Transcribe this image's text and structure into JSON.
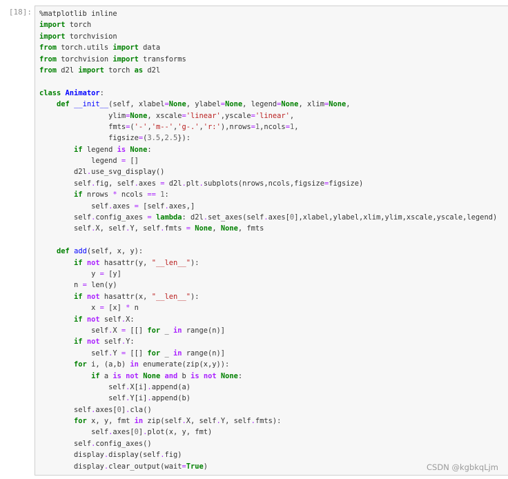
{
  "cell": {
    "prompt": "[18]:"
  },
  "watermark": "CSDN @kgbkqLjm",
  "code_lines": [
    [
      [
        "mg",
        "%matplotlib inline"
      ]
    ],
    [
      [
        "k",
        "import"
      ],
      [
        "t",
        " torch"
      ]
    ],
    [
      [
        "k",
        "import"
      ],
      [
        "t",
        " torchvision"
      ]
    ],
    [
      [
        "k",
        "from"
      ],
      [
        "t",
        " torch.utils "
      ],
      [
        "k",
        "import"
      ],
      [
        "t",
        " data"
      ]
    ],
    [
      [
        "k",
        "from"
      ],
      [
        "t",
        " torchvision "
      ],
      [
        "k",
        "import"
      ],
      [
        "t",
        " transforms"
      ]
    ],
    [
      [
        "k",
        "from"
      ],
      [
        "t",
        " d2l "
      ],
      [
        "k",
        "import"
      ],
      [
        "t",
        " torch "
      ],
      [
        "k",
        "as"
      ],
      [
        "t",
        " d2l"
      ]
    ],
    [],
    [
      [
        "k",
        "class"
      ],
      [
        "t",
        " "
      ],
      [
        "nc",
        "Animator"
      ],
      [
        "t",
        ":"
      ]
    ],
    [
      [
        "t",
        "    "
      ],
      [
        "k",
        "def"
      ],
      [
        "t",
        " "
      ],
      [
        "nf",
        "__init__"
      ],
      [
        "t",
        "(self, xlabel"
      ],
      [
        "o",
        "="
      ],
      [
        "kc",
        "None"
      ],
      [
        "t",
        ", ylabel"
      ],
      [
        "o",
        "="
      ],
      [
        "kc",
        "None"
      ],
      [
        "t",
        ", legend"
      ],
      [
        "o",
        "="
      ],
      [
        "kc",
        "None"
      ],
      [
        "t",
        ", xlim"
      ],
      [
        "o",
        "="
      ],
      [
        "kc",
        "None"
      ],
      [
        "t",
        ","
      ]
    ],
    [
      [
        "t",
        "                ylim"
      ],
      [
        "o",
        "="
      ],
      [
        "kc",
        "None"
      ],
      [
        "t",
        ", xscale"
      ],
      [
        "o",
        "="
      ],
      [
        "s",
        "'linear'"
      ],
      [
        "t",
        ",yscale"
      ],
      [
        "o",
        "="
      ],
      [
        "s",
        "'linear'"
      ],
      [
        "t",
        ","
      ]
    ],
    [
      [
        "t",
        "                fmts"
      ],
      [
        "o",
        "="
      ],
      [
        "t",
        "("
      ],
      [
        "s",
        "'-'"
      ],
      [
        "t",
        ","
      ],
      [
        "s",
        "'m--'"
      ],
      [
        "t",
        ","
      ],
      [
        "s",
        "'g-.'"
      ],
      [
        "t",
        ","
      ],
      [
        "s",
        "'r:'"
      ],
      [
        "t",
        "),nrows"
      ],
      [
        "o",
        "="
      ],
      [
        "m",
        "1"
      ],
      [
        "t",
        ",ncols"
      ],
      [
        "o",
        "="
      ],
      [
        "m",
        "1"
      ],
      [
        "t",
        ","
      ]
    ],
    [
      [
        "t",
        "                figsize"
      ],
      [
        "o",
        "="
      ],
      [
        "t",
        "("
      ],
      [
        "m",
        "3.5"
      ],
      [
        "t",
        ","
      ],
      [
        "m",
        "2.5"
      ],
      [
        "t",
        "}):"
      ]
    ],
    [
      [
        "t",
        "        "
      ],
      [
        "k",
        "if"
      ],
      [
        "t",
        " legend "
      ],
      [
        "ow",
        "is"
      ],
      [
        "t",
        " "
      ],
      [
        "kc",
        "None"
      ],
      [
        "t",
        ":"
      ]
    ],
    [
      [
        "t",
        "            legend "
      ],
      [
        "o",
        "="
      ],
      [
        "t",
        " []"
      ]
    ],
    [
      [
        "t",
        "        d2l"
      ],
      [
        "o",
        "."
      ],
      [
        "t",
        "use_svg_display()"
      ]
    ],
    [
      [
        "t",
        "        self"
      ],
      [
        "o",
        "."
      ],
      [
        "t",
        "fig, self"
      ],
      [
        "o",
        "."
      ],
      [
        "t",
        "axes "
      ],
      [
        "o",
        "="
      ],
      [
        "t",
        " d2l"
      ],
      [
        "o",
        "."
      ],
      [
        "t",
        "plt"
      ],
      [
        "o",
        "."
      ],
      [
        "t",
        "subplots(nrows,ncols,figsize"
      ],
      [
        "o",
        "="
      ],
      [
        "t",
        "figsize)"
      ]
    ],
    [
      [
        "t",
        "        "
      ],
      [
        "k",
        "if"
      ],
      [
        "t",
        " nrows "
      ],
      [
        "o",
        "*"
      ],
      [
        "t",
        " ncols "
      ],
      [
        "o",
        "=="
      ],
      [
        "t",
        " "
      ],
      [
        "m",
        "1"
      ],
      [
        "t",
        ":"
      ]
    ],
    [
      [
        "t",
        "            self"
      ],
      [
        "o",
        "."
      ],
      [
        "t",
        "axes "
      ],
      [
        "o",
        "="
      ],
      [
        "t",
        " [self"
      ],
      [
        "o",
        "."
      ],
      [
        "t",
        "axes,]"
      ]
    ],
    [
      [
        "t",
        "        self"
      ],
      [
        "o",
        "."
      ],
      [
        "t",
        "config_axes "
      ],
      [
        "o",
        "="
      ],
      [
        "t",
        " "
      ],
      [
        "k",
        "lambda"
      ],
      [
        "t",
        ": d2l"
      ],
      [
        "o",
        "."
      ],
      [
        "t",
        "set_axes(self"
      ],
      [
        "o",
        "."
      ],
      [
        "t",
        "axes["
      ],
      [
        "m",
        "0"
      ],
      [
        "t",
        "],xlabel,ylabel,xlim,ylim,xscale,yscale,legend)"
      ]
    ],
    [
      [
        "t",
        "        self"
      ],
      [
        "o",
        "."
      ],
      [
        "t",
        "X, self"
      ],
      [
        "o",
        "."
      ],
      [
        "t",
        "Y, self"
      ],
      [
        "o",
        "."
      ],
      [
        "t",
        "fmts "
      ],
      [
        "o",
        "="
      ],
      [
        "t",
        " "
      ],
      [
        "kc",
        "None"
      ],
      [
        "t",
        ", "
      ],
      [
        "kc",
        "None"
      ],
      [
        "t",
        ", fmts"
      ]
    ],
    [],
    [
      [
        "t",
        "    "
      ],
      [
        "k",
        "def"
      ],
      [
        "t",
        " "
      ],
      [
        "nf",
        "add"
      ],
      [
        "t",
        "(self, x, y):"
      ]
    ],
    [
      [
        "t",
        "        "
      ],
      [
        "k",
        "if"
      ],
      [
        "t",
        " "
      ],
      [
        "ow",
        "not"
      ],
      [
        "t",
        " hasattr(y, "
      ],
      [
        "s",
        "\"__len__\""
      ],
      [
        "t",
        "):"
      ]
    ],
    [
      [
        "t",
        "            y "
      ],
      [
        "o",
        "="
      ],
      [
        "t",
        " [y]"
      ]
    ],
    [
      [
        "t",
        "        n "
      ],
      [
        "o",
        "="
      ],
      [
        "t",
        " len(y)"
      ]
    ],
    [
      [
        "t",
        "        "
      ],
      [
        "k",
        "if"
      ],
      [
        "t",
        " "
      ],
      [
        "ow",
        "not"
      ],
      [
        "t",
        " hasattr(x, "
      ],
      [
        "s",
        "\"__len__\""
      ],
      [
        "t",
        "):"
      ]
    ],
    [
      [
        "t",
        "            x "
      ],
      [
        "o",
        "="
      ],
      [
        "t",
        " [x] "
      ],
      [
        "o",
        "*"
      ],
      [
        "t",
        " n"
      ]
    ],
    [
      [
        "t",
        "        "
      ],
      [
        "k",
        "if"
      ],
      [
        "t",
        " "
      ],
      [
        "ow",
        "not"
      ],
      [
        "t",
        " self"
      ],
      [
        "o",
        "."
      ],
      [
        "t",
        "X:"
      ]
    ],
    [
      [
        "t",
        "            self"
      ],
      [
        "o",
        "."
      ],
      [
        "t",
        "X "
      ],
      [
        "o",
        "="
      ],
      [
        "t",
        " [[] "
      ],
      [
        "k",
        "for"
      ],
      [
        "t",
        " _ "
      ],
      [
        "ow",
        "in"
      ],
      [
        "t",
        " range(n)]"
      ]
    ],
    [
      [
        "t",
        "        "
      ],
      [
        "k",
        "if"
      ],
      [
        "t",
        " "
      ],
      [
        "ow",
        "not"
      ],
      [
        "t",
        " self"
      ],
      [
        "o",
        "."
      ],
      [
        "t",
        "Y:"
      ]
    ],
    [
      [
        "t",
        "            self"
      ],
      [
        "o",
        "."
      ],
      [
        "t",
        "Y "
      ],
      [
        "o",
        "="
      ],
      [
        "t",
        " [[] "
      ],
      [
        "k",
        "for"
      ],
      [
        "t",
        " _ "
      ],
      [
        "ow",
        "in"
      ],
      [
        "t",
        " range(n)]"
      ]
    ],
    [
      [
        "t",
        "        "
      ],
      [
        "k",
        "for"
      ],
      [
        "t",
        " i, (a,b) "
      ],
      [
        "ow",
        "in"
      ],
      [
        "t",
        " enumerate(zip(x,y)):"
      ]
    ],
    [
      [
        "t",
        "            "
      ],
      [
        "k",
        "if"
      ],
      [
        "t",
        " a "
      ],
      [
        "ow",
        "is"
      ],
      [
        "t",
        " "
      ],
      [
        "ow",
        "not"
      ],
      [
        "t",
        " "
      ],
      [
        "kc",
        "None"
      ],
      [
        "t",
        " "
      ],
      [
        "ow",
        "and"
      ],
      [
        "t",
        " b "
      ],
      [
        "ow",
        "is"
      ],
      [
        "t",
        " "
      ],
      [
        "ow",
        "not"
      ],
      [
        "t",
        " "
      ],
      [
        "kc",
        "None"
      ],
      [
        "t",
        ":"
      ]
    ],
    [
      [
        "t",
        "                self"
      ],
      [
        "o",
        "."
      ],
      [
        "t",
        "X[i]"
      ],
      [
        "o",
        "."
      ],
      [
        "t",
        "append(a)"
      ]
    ],
    [
      [
        "t",
        "                self"
      ],
      [
        "o",
        "."
      ],
      [
        "t",
        "Y[i]"
      ],
      [
        "o",
        "."
      ],
      [
        "t",
        "append(b)"
      ]
    ],
    [
      [
        "t",
        "        self"
      ],
      [
        "o",
        "."
      ],
      [
        "t",
        "axes["
      ],
      [
        "m",
        "0"
      ],
      [
        "t",
        "]"
      ],
      [
        "o",
        "."
      ],
      [
        "t",
        "cla()"
      ]
    ],
    [
      [
        "t",
        "        "
      ],
      [
        "k",
        "for"
      ],
      [
        "t",
        " x, y, fmt "
      ],
      [
        "ow",
        "in"
      ],
      [
        "t",
        " zip(self"
      ],
      [
        "o",
        "."
      ],
      [
        "t",
        "X, self"
      ],
      [
        "o",
        "."
      ],
      [
        "t",
        "Y, self"
      ],
      [
        "o",
        "."
      ],
      [
        "t",
        "fmts):"
      ]
    ],
    [
      [
        "t",
        "            self"
      ],
      [
        "o",
        "."
      ],
      [
        "t",
        "axes["
      ],
      [
        "m",
        "0"
      ],
      [
        "t",
        "]"
      ],
      [
        "o",
        "."
      ],
      [
        "t",
        "plot(x, y, fmt)"
      ]
    ],
    [
      [
        "t",
        "        self"
      ],
      [
        "o",
        "."
      ],
      [
        "t",
        "config_axes()"
      ]
    ],
    [
      [
        "t",
        "        display"
      ],
      [
        "o",
        "."
      ],
      [
        "t",
        "display(self"
      ],
      [
        "o",
        "."
      ],
      [
        "t",
        "fig)"
      ]
    ],
    [
      [
        "t",
        "        display"
      ],
      [
        "o",
        "."
      ],
      [
        "t",
        "clear_output(wait"
      ],
      [
        "o",
        "="
      ],
      [
        "kc",
        "True"
      ],
      [
        "t",
        ")"
      ]
    ]
  ]
}
